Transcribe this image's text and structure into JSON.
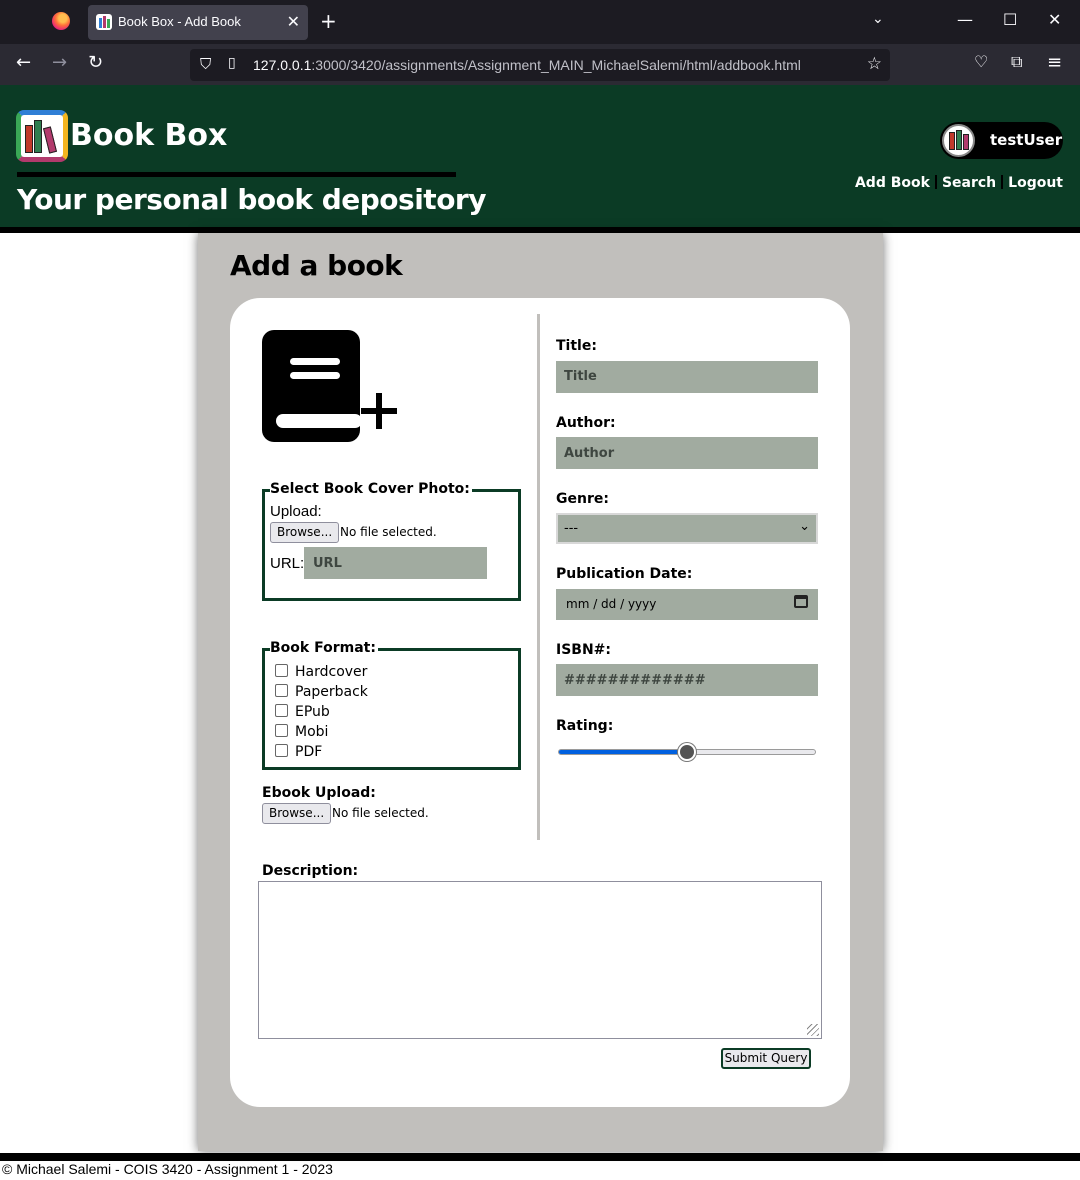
{
  "browser": {
    "tab_title": "Book Box - Add Book",
    "url_host": "127.0.0.1",
    "url_path": ":3000/3420/assignments/Assignment_MAIN_MichaelSalemi/html/addbook.html"
  },
  "header": {
    "site_title": "Book Box",
    "tagline": "Your personal book depository",
    "username": "testUser",
    "nav": [
      "Add Book",
      "Search",
      "Logout"
    ]
  },
  "form": {
    "page_title": "Add a book",
    "cover": {
      "legend": "Select Book Cover Photo:",
      "upload_label": "Upload:",
      "browse_label": "Browse...",
      "no_file": "No file selected.",
      "url_label": "URL:",
      "url_placeholder": "URL"
    },
    "format": {
      "legend": "Book Format:",
      "options": [
        "Hardcover",
        "Paperback",
        "EPub",
        "Mobi",
        "PDF"
      ]
    },
    "ebook": {
      "label": "Ebook Upload:",
      "browse_label": "Browse...",
      "no_file": "No file selected."
    },
    "title": {
      "label": "Title:",
      "placeholder": "Title"
    },
    "author": {
      "label": "Author:",
      "placeholder": "Author"
    },
    "genre": {
      "label": "Genre:",
      "value": "---"
    },
    "pub_date": {
      "label": "Publication Date:",
      "placeholder": "mm / dd / yyyy"
    },
    "isbn": {
      "label": "ISBN#:",
      "placeholder": "#############"
    },
    "rating": {
      "label": "Rating:",
      "fraction": 0.5
    },
    "description": {
      "label": "Description:"
    },
    "submit_label": "Submit Query"
  },
  "footer": {
    "text": "© Michael Salemi - COIS 3420 - Assignment 1 - 2023"
  },
  "colors": {
    "header_bg": "#0b3b25",
    "panel_bg": "#c1bfbc",
    "input_bg": "#a1aba0",
    "accent": "#0060df"
  }
}
